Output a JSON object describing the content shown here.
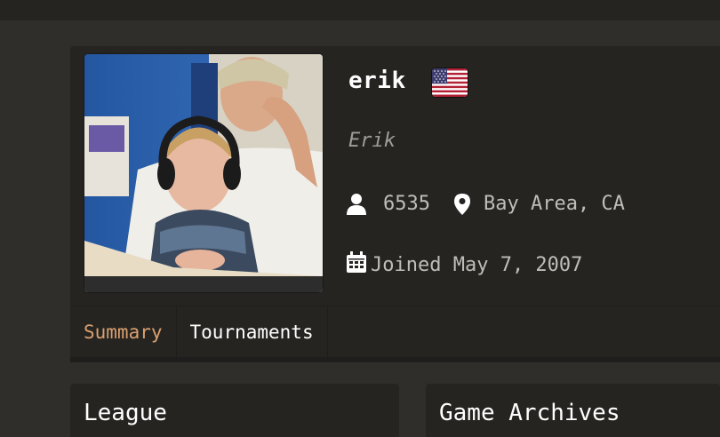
{
  "profile": {
    "username": "erik",
    "real_name": "Erik",
    "followers": "6535",
    "location": "Bay Area, CA",
    "joined": "Joined May 7, 2007",
    "country_flag": "us-flag-icon"
  },
  "tabs": [
    {
      "label": "Summary",
      "active": true
    },
    {
      "label": "Tournaments",
      "active": false
    }
  ],
  "panels": {
    "league_title": "League",
    "archives_title": "Game Archives"
  },
  "colors": {
    "background": "#302e2b",
    "card": "#262421",
    "active_tab": "#d9a070"
  }
}
